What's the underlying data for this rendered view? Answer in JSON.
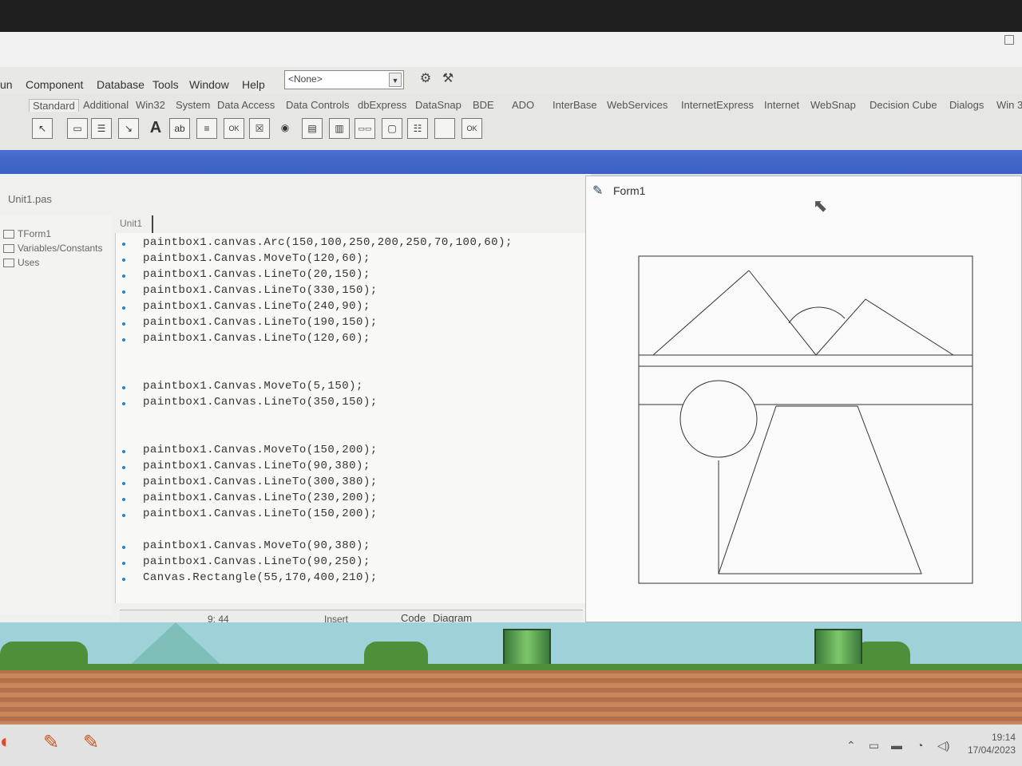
{
  "menu": [
    "un",
    "Component",
    "Database",
    "Tools",
    "Window",
    "Help"
  ],
  "combo": {
    "value": "<None>"
  },
  "palette_tabs": [
    "Standard",
    "Additional",
    "Win32",
    "System",
    "Data Access",
    "Data Controls",
    "dbExpress",
    "DataSnap",
    "BDE",
    "ADO",
    "InterBase",
    "WebServices",
    "InternetExpress",
    "Internet",
    "WebSnap",
    "Decision Cube",
    "Dialogs",
    "Win 3"
  ],
  "components": [
    "pointer",
    "frames",
    "mainmenu",
    "popupmenu",
    "A",
    "abl",
    "memo",
    "OK",
    "X",
    "radio",
    "listbox",
    "combobox",
    "scrollbar",
    "groupbox",
    "radiogroup",
    "panel",
    "actionlist"
  ],
  "editor": {
    "file_title": "Unit1.pas",
    "tab": "Unit1",
    "tree": [
      "TForm1",
      "Variables/Constants",
      "Uses"
    ],
    "code": [
      "paintbox1.canvas.Arc(150,100,250,200,250,70,100,60);",
      "paintbox1.Canvas.MoveTo(120,60);",
      "paintbox1.Canvas.LineTo(20,150);",
      "paintbox1.Canvas.LineTo(330,150);",
      "paintbox1.Canvas.LineTo(240,90);",
      "paintbox1.Canvas.LineTo(190,150);",
      "paintbox1.Canvas.LineTo(120,60);",
      "",
      "",
      "paintbox1.Canvas.MoveTo(5,150);",
      "paintbox1.Canvas.LineTo(350,150);",
      "",
      "",
      "paintbox1.Canvas.MoveTo(150,200);",
      "paintbox1.Canvas.LineTo(90,380);",
      "paintbox1.Canvas.LineTo(300,380);",
      "paintbox1.Canvas.LineTo(230,200);",
      "paintbox1.Canvas.LineTo(150,200);",
      "",
      "paintbox1.Canvas.MoveTo(90,380);",
      "paintbox1.Canvas.LineTo(90,250);",
      "Canvas.Rectangle(55,170,400,210);"
    ],
    "status": {
      "position": "9: 44",
      "mode": "Insert",
      "tab_code": "Code",
      "tab_diagram": "Diagram"
    }
  },
  "form1": {
    "title": "Form1"
  },
  "clock": {
    "time": "19:14",
    "date": "17/04/2023"
  }
}
